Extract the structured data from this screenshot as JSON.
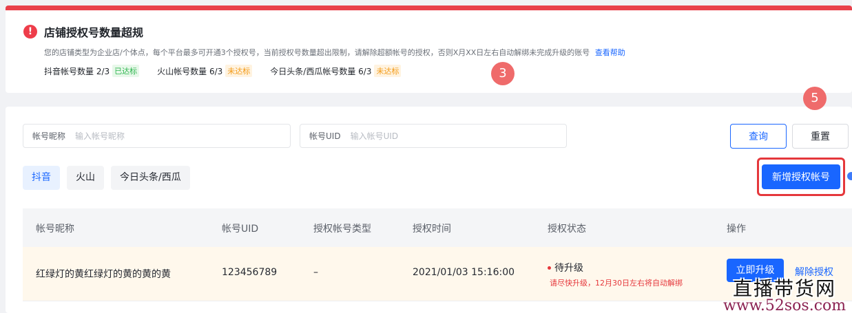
{
  "alert": {
    "title": "店铺授权号数量超规",
    "icon": "exclamation-icon",
    "icon_glyph": "!",
    "description": "您的店铺类型为企业店/个体点，每个平台最多可开通3个授权号，当前授权号数量超出限制，请解除超额帐号的授权，否则X月XX日左右自动解绑未完成升级的账号",
    "help_link": "查看帮助",
    "counts": [
      {
        "label": "抖音帐号数量 2/3",
        "tag": "已达标"
      },
      {
        "label": "火山帐号数量 6/3",
        "tag": "未达标"
      },
      {
        "label": "今日头条/西瓜帐号数量 6/3",
        "tag": "未达标"
      }
    ]
  },
  "markers": {
    "step_a": "3",
    "step_b": "5"
  },
  "search": {
    "nickname_label": "帐号昵称",
    "nickname_placeholder": "输入帐号昵称",
    "uid_label": "帐号UID",
    "uid_placeholder": "输入帐号UID",
    "query_button": "查询",
    "reset_button": "重置"
  },
  "tabs": [
    {
      "label": "抖音",
      "active": true
    },
    {
      "label": "火山",
      "active": false
    },
    {
      "label": "今日头条/西瓜",
      "active": false
    }
  ],
  "add_button": "新增授权帐号",
  "table": {
    "columns": [
      "帐号昵称",
      "帐号UID",
      "授权帐号类型",
      "授权时间",
      "授权状态",
      "操作"
    ],
    "rows": [
      {
        "nickname": "红绿灯的黄红绿灯的黄的黄的黄",
        "uid": "123456789",
        "type": "–",
        "time": "2021/01/03 15:16:00",
        "status": "待升级",
        "status_note": "请尽快升级，12月30日左右将自动解绑",
        "action_primary": "立即升级",
        "action_secondary": "解除授权"
      }
    ]
  },
  "watermark": {
    "title": "直播带货网",
    "url": "www.52sos.com"
  },
  "colors": {
    "primary": "#1966ff",
    "danger": "#e5373b",
    "success": "#2fb64f",
    "warning": "#f39a16",
    "row_highlight": "#fff8ec"
  }
}
